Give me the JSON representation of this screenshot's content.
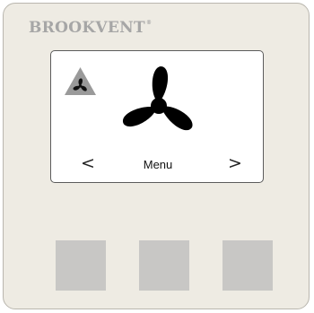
{
  "brand": {
    "name": "BROOKVENT",
    "mark": "®"
  },
  "screen": {
    "mode_icon": "fan-warning-icon",
    "main_icon": "fan-icon",
    "nav_left": "<",
    "nav_right": ">",
    "menu_label": "Menu"
  },
  "buttons": [
    {
      "name": "left-button"
    },
    {
      "name": "center-button"
    },
    {
      "name": "right-button"
    }
  ],
  "colors": {
    "panel": "#eeebe3",
    "brand_text": "#a6a6a6",
    "screen_bg": "#ffffff",
    "mode_icon_bg": "#9a9a9a",
    "fan": "#000000",
    "button": "#c8c7c5"
  }
}
